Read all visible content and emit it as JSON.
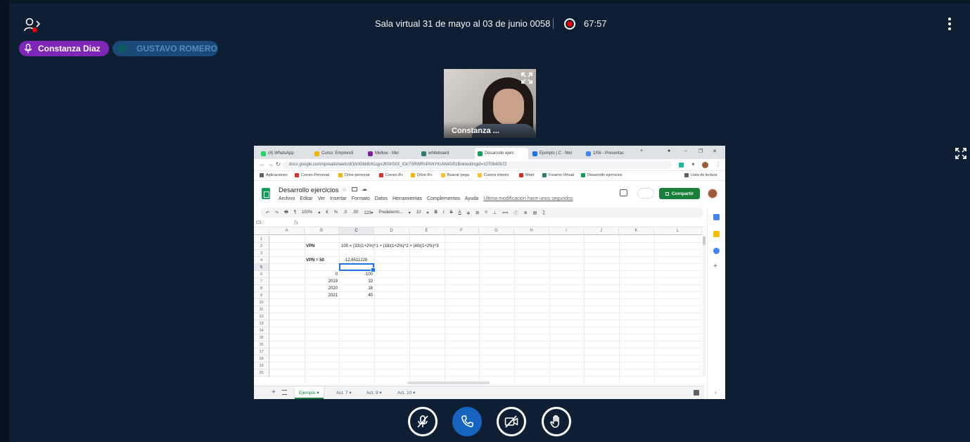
{
  "header": {
    "room_title": "Sala virtual 31 de mayo al 03 de junio 0058",
    "recording_time": "67:57"
  },
  "presenters": [
    {
      "name": "Constanza Diaz",
      "state": "talking",
      "color": "#7e26b8"
    },
    {
      "name": "GUSTAVO ROMERO",
      "state": "muted",
      "color": "#1c4a78"
    }
  ],
  "webcam": {
    "name": "Constanza ..."
  },
  "browser": {
    "tabs": [
      "(4) WhatsApp",
      "Curso: Emprendi",
      "Mellow - Mel",
      "whiteboard",
      "Desarrollo ejerc",
      "Ejemplo | C - Mel",
      "1/06 - Presentac"
    ],
    "window_controls": [
      "–",
      "❐",
      "✕"
    ],
    "url": "docs.google.com/spreadsheets/d/1h0G6kBr61qyvJKNr0XX_iOc7SRWRnPANYKsNWGRzBnk/edit#gid=1070640972",
    "bookmarks": [
      "Aplicaciones",
      "Correo Personal",
      "Drive personal",
      "Correo R+",
      "Drive R+",
      "Buscar pega",
      "Cursos interés",
      "Meet",
      "Foramo Virtual",
      "Desarrollo ejercicios"
    ],
    "reading_list": "Lista de lectura"
  },
  "sheet": {
    "title": "Desarrollo ejercicios",
    "menu": [
      "Archivo",
      "Editar",
      "Ver",
      "Insertar",
      "Formato",
      "Datos",
      "Herramientas",
      "Complementos",
      "Ayuda"
    ],
    "last_edit": "Última modificación hace unos segundos",
    "share_label": "Compartir",
    "toolbar": [
      "↶",
      "↷",
      "🖶",
      "¶",
      "100%",
      "▾",
      "€",
      "%",
      ".0",
      ".00",
      "123▾",
      "Predetermi...",
      "▾",
      "10",
      "▾",
      "B",
      "I",
      "S",
      "A",
      "⬙",
      "⊞",
      "≡",
      "⊥",
      "⟺",
      "ⓘ",
      "⊕",
      "▤",
      "∑"
    ],
    "cell_ref": "C5",
    "columns": [
      "A",
      "B",
      "C",
      "D",
      "E",
      "F",
      "G",
      "H",
      "I",
      "J",
      "K",
      "L"
    ],
    "rows": [
      "1",
      "2",
      "3",
      "4",
      "5",
      "6",
      "7",
      "8",
      "9",
      "10",
      "11",
      "12",
      "13",
      "14",
      "15",
      "16",
      "17",
      "18",
      "19",
      "20"
    ],
    "cells": {
      "b2": "VPN",
      "c2": "100 = (33/(1+2%)^1 + (18/(1+2%)^2 + (40/(1+2%)^3",
      "b4": "VPN =  50",
      "c4": "-12,6511228",
      "b6": "0",
      "c6": "-100",
      "b7": "2019",
      "c7": "33",
      "b8": "2020",
      "c8": "18",
      "b9": "2021",
      "c9": "40"
    },
    "sheet_tabs": [
      "Ejemplo ▾",
      "Act. 7 ▾",
      "Act. 9 ▾",
      "Act. 10 ▾"
    ]
  }
}
